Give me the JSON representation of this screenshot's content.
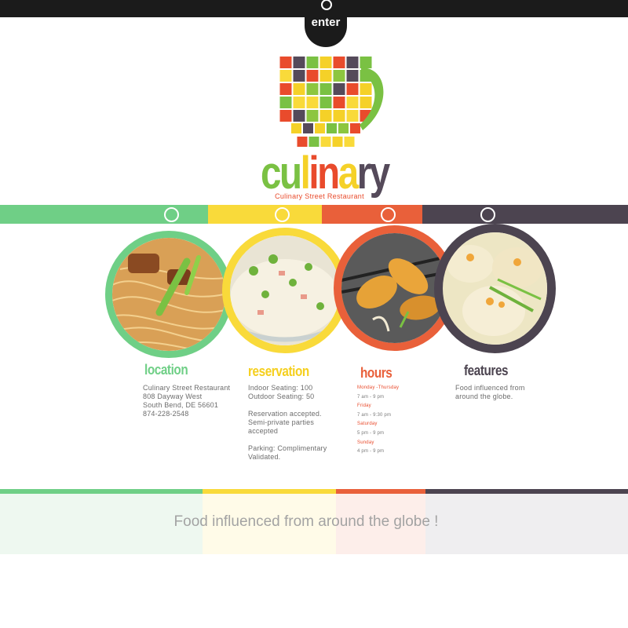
{
  "header": {
    "enter_label": "enter"
  },
  "logo": {
    "letters": [
      {
        "char": "c",
        "color": "#7ac143"
      },
      {
        "char": "u",
        "color": "#7ac143"
      },
      {
        "char": "l",
        "color": "#f5d128"
      },
      {
        "char": "i",
        "color": "#e94b2c"
      },
      {
        "char": "n",
        "color": "#e94b2c"
      },
      {
        "char": "a",
        "color": "#f5d128"
      },
      {
        "char": "r",
        "color": "#554a5a"
      },
      {
        "char": "y",
        "color": "#554a5a"
      }
    ],
    "subtitle": "Culinary Street Restaurant",
    "cup_icon": "mosaic-cup-icon"
  },
  "colors": {
    "green": "#6fcf86",
    "yellow": "#f9da3a",
    "orange": "#e9603a",
    "purple": "#4c4450"
  },
  "columns": [
    {
      "title": "location",
      "title_color": "#6fcf86",
      "lines": [
        "Culinary Street Restaurant",
        "808  Dayway West",
        "South Bend, DE 56601",
        "874-228-2548"
      ],
      "image": "noodles"
    },
    {
      "title": "reservation",
      "title_color": "#f5cf1e",
      "paragraphs": [
        [
          "Indoor Seating: 100",
          "Outdoor Seating: 50"
        ],
        [
          "Reservation accepted.",
          "Semi-private parties",
          "accepted"
        ],
        [
          "Parking: Complimentary",
          "Validated."
        ]
      ],
      "image": "fried rice"
    },
    {
      "title": "hours",
      "title_color": "#e9603a",
      "schedule": [
        {
          "day": "Monday -Thursday",
          "time": "7 am - 9 pm"
        },
        {
          "day": "Friday",
          "time": "7 am - 9:30 pm"
        },
        {
          "day": "Saturday",
          "time": "5 pm - 9 pm"
        },
        {
          "day": "Sunday",
          "time": "4 pm - 9 pm"
        }
      ],
      "image": "spring rolls"
    },
    {
      "title": "features",
      "title_color": "#4c4450",
      "lines": [
        "Food influenced from",
        "around the globe."
      ],
      "image": "dumplings"
    }
  ],
  "footer": {
    "tagline": "Food influenced from around the globe !"
  }
}
